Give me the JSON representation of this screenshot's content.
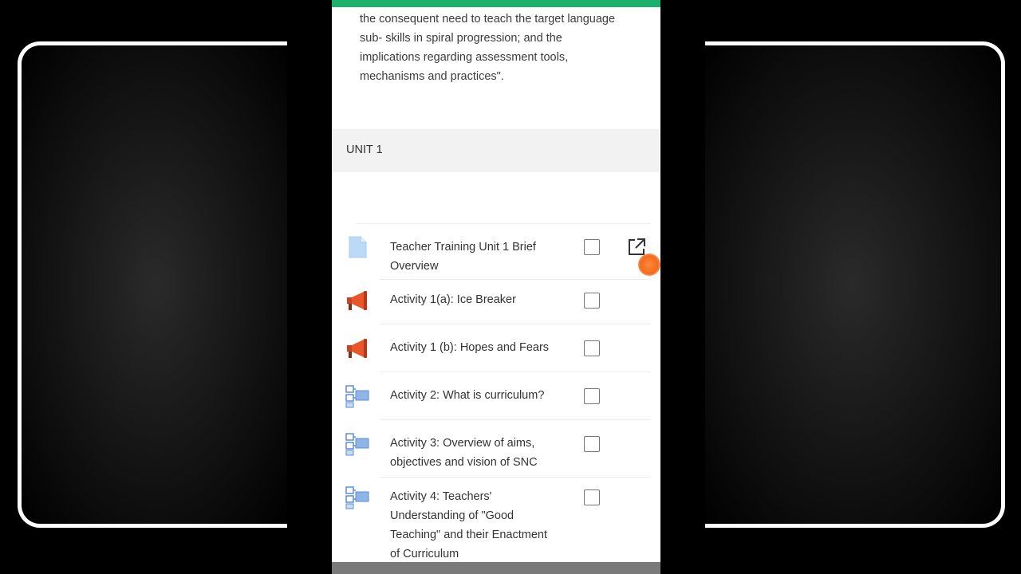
{
  "intro_lines": [
    "the consequent need to teach the target language",
    "sub- skills in spiral progression; and the",
    "implications regarding assessment tools,",
    "mechanisms and practices\"."
  ],
  "unit": {
    "title": "UNIT 1"
  },
  "activities": [
    {
      "icon": "file-icon",
      "title_lines": [
        "Teacher Training Unit 1 Brief",
        "Overview"
      ],
      "completed": false,
      "has_external_link": true
    },
    {
      "icon": "megaphone-icon",
      "title_lines": [
        "Activity 1(a): Ice Breaker"
      ],
      "completed": false
    },
    {
      "icon": "megaphone-icon",
      "title_lines": [
        "Activity 1 (b): Hopes and Fears"
      ],
      "completed": false
    },
    {
      "icon": "workshop-icon",
      "title_lines": [
        "Activity 2: What is curriculum?"
      ],
      "completed": false
    },
    {
      "icon": "workshop-icon",
      "title_lines": [
        "Activity 3: Overview of aims,",
        "objectives and vision of SNC"
      ],
      "completed": false
    },
    {
      "icon": "workshop-icon",
      "title_lines": [
        "Activity 4: Teachers'",
        "Understanding of \"Good",
        "Teaching\" and their Enactment",
        "of Curriculum"
      ],
      "completed": false
    }
  ],
  "colors": {
    "accent_bar": "#1db06a",
    "megaphone": "#e8562a",
    "workshop": "#5b8ed6",
    "file": "#bcd9f5"
  }
}
